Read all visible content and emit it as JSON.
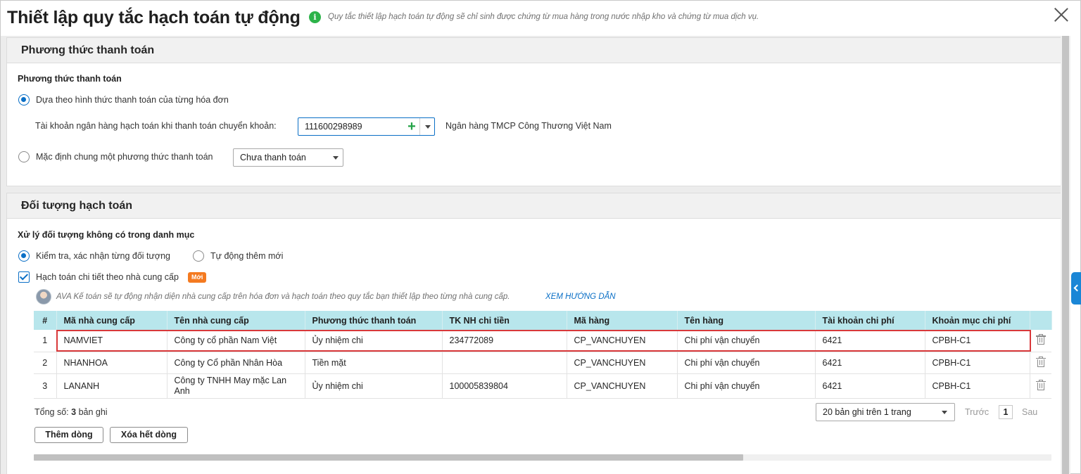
{
  "header": {
    "title": "Thiết lập quy tắc hạch toán tự động",
    "info_text": "Quy tắc thiết lập hạch toán tự động sẽ chỉ sinh được chứng từ mua hàng trong nước nhập kho và chứng từ mua dịch vụ.",
    "info_icon": "info-icon",
    "close_icon": "close-icon"
  },
  "payment": {
    "section_title": "Phương thức thanh toán",
    "group_label": "Phương thức thanh toán",
    "option_by_invoice": "Dựa theo hình thức thanh toán của từng hóa đơn",
    "option_by_invoice_selected": true,
    "bank_account_label": "Tài khoản ngân hàng hạch toán khi thanh toán chuyển khoản:",
    "bank_account_value": "111600298989",
    "bank_name": "Ngân hàng TMCP Công Thương Việt Nam",
    "option_default": "Mặc định chung một phương thức thanh toán",
    "option_default_selected": false,
    "default_method_value": "Chưa thanh toán"
  },
  "accounting_object": {
    "section_title": "Đối tượng hạch toán",
    "group_label": "Xử lý đối tượng không có trong danh mục",
    "option_check": "Kiểm tra, xác nhận từng đối tượng",
    "option_check_selected": true,
    "option_auto_add": "Tự động thêm mới",
    "option_auto_add_selected": false,
    "detail_by_supplier_label": "Hạch toán chi tiết theo nhà cung cấp",
    "detail_by_supplier_checked": true,
    "new_badge": "Mới",
    "ava_hint": "AVA Kế toán sẽ tự động nhận diện nhà cung cấp trên hóa đơn và hạch toán theo quy tắc bạn thiết lập theo từng nhà cung cấp.",
    "ava_link": "XEM HƯỚNG DẪN"
  },
  "table": {
    "columns": [
      "#",
      "Mã nhà cung cấp",
      "Tên nhà cung cấp",
      "Phương thức thanh toán",
      "TK NH chi tiền",
      "Mã hàng",
      "Tên hàng",
      "Tài khoản chi phí",
      "Khoản mục chi phí"
    ],
    "rows": [
      [
        "1",
        "NAMVIET",
        "Công ty cổ phần Nam Việt",
        "Ủy nhiệm chi",
        "234772089",
        "CP_VANCHUYEN",
        "Chi phí vận chuyển",
        "6421",
        "CPBH-C1"
      ],
      [
        "2",
        "NHANHOA",
        "Công ty Cổ phần Nhân Hòa",
        "Tiền mặt",
        "",
        "CP_VANCHUYEN",
        "Chi phí vận chuyển",
        "6421",
        "CPBH-C1"
      ],
      [
        "3",
        "LANANH",
        "Công ty TNHH May mặc Lan Anh",
        "Ủy nhiệm chi",
        "100005839804",
        "CP_VANCHUYEN",
        "Chi phí vận chuyển",
        "6421",
        "CPBH-C1"
      ]
    ],
    "delete_icon": "trash-icon"
  },
  "footer": {
    "total_prefix": "Tổng số:",
    "total_count": "3",
    "total_suffix": "bản ghi",
    "page_size": "20 bản ghi trên 1 trang",
    "prev": "Trước",
    "page": "1",
    "next": "Sau",
    "add_row": "Thêm dòng",
    "clear_rows": "Xóa hết dòng"
  },
  "colors": {
    "accent": "#0a6fc6",
    "table_header": "#b8e6ec",
    "highlight": "#d9383a",
    "new_badge": "#f47a20",
    "info_icon": "#2db34a"
  }
}
